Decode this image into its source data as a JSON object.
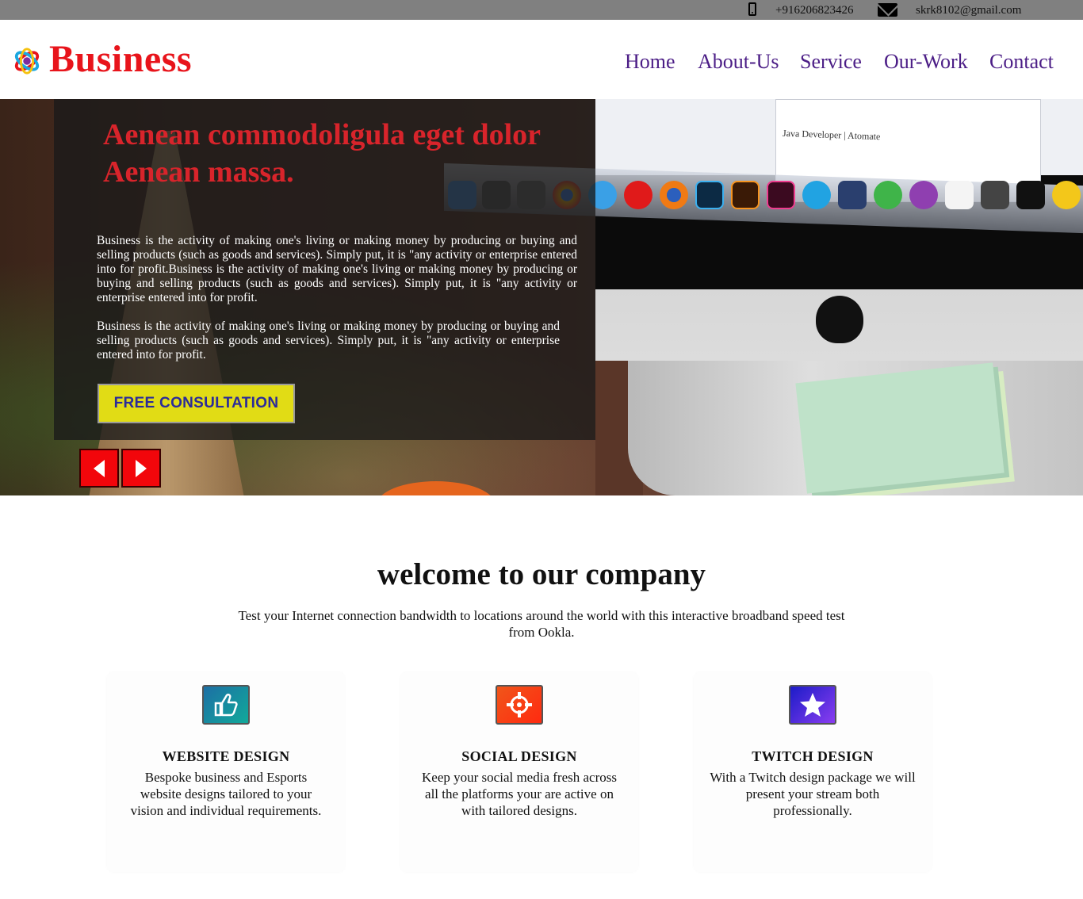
{
  "topbar": {
    "phone": "+916206823426",
    "email": "skrk8102@gmail.com",
    "phone_icon": "phone-icon",
    "mail_icon": "envelope-icon"
  },
  "header": {
    "logo_text": "Business",
    "nav": [
      "Home",
      "About-Us",
      "Service",
      "Our-Work",
      "Contact"
    ],
    "colors": {
      "logo": "#e8141b",
      "nav": "#4b1d86"
    }
  },
  "hero": {
    "title": "Aenean commodoligula eget dolor Aenean massa.",
    "paragraph_1": "Business is the activity of making one's living or making money by producing or buying and selling products (such as goods and services). Simply put, it is \"any activity or enterprise entered into for profit.Business is the activity of making one's living or making money by producing or buying and selling products (such as goods and services). Simply put, it is \"any activity or enterprise entered into for profit.",
    "paragraph_2": "Business is the activity of making one's living or making money by producing or buying and selling products (such as goods and services). Simply put, it is \"any activity or enterprise entered into for profit.",
    "cta_label": "FREE CONSULTATION",
    "screen_text": "Java Developer | Atomate",
    "colors": {
      "title": "#d8242b",
      "cta_bg": "#e1dc15",
      "cta_text": "#2b2b9a",
      "arrow_bg": "#f2060b"
    }
  },
  "welcome": {
    "title": "welcome to our company",
    "text": "Test your Internet connection bandwidth to locations around the world with this interactive broadband speed test from Ookla."
  },
  "services": [
    {
      "icon": "thumbs-up-icon",
      "title": "WEBSITE DESIGN",
      "text": "Bespoke business and Esports website designs tailored to your vision and individual requirements."
    },
    {
      "icon": "crosshair-icon",
      "title": "SOCIAL DESIGN",
      "text": "Keep your social media fresh across all the platforms your are active on with tailored designs."
    },
    {
      "icon": "star-icon",
      "title": "TWITCH DESIGN",
      "text": "With a Twitch design package we will present your stream both professionally."
    }
  ]
}
